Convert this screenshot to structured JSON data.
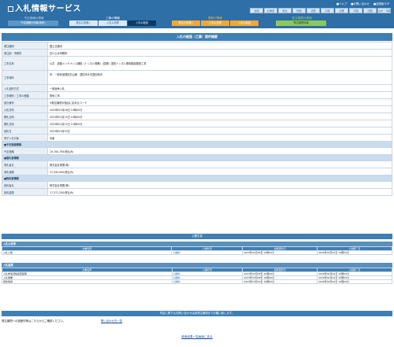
{
  "header": {
    "title": "入札情報サービス",
    "links": [
      "ヘルプ",
      "お問い合わせ",
      "全国版TOP"
    ],
    "prefectures": [
      "全国",
      "北海道",
      "東北",
      "関東",
      "北陸",
      "中部",
      "近畿",
      "中国",
      "四国",
      "九州・沖縄"
    ]
  },
  "categories": {
    "g1": {
      "label": "予定価格の情報",
      "tabs": [
        "予定価格の情報(参考)"
      ]
    },
    "g2": {
      "label": "工事の情報",
      "tabs": [
        "発注の見通し",
        "入札公告等",
        "入札の経過"
      ]
    },
    "g3": {
      "label": "業務の情報",
      "tabs": [
        "発注の見通し",
        "入札公告等",
        "入札の経過"
      ]
    },
    "g4": {
      "label": "発注機関の情報",
      "tabs": [
        "発注機関情報"
      ]
    }
  },
  "detail": {
    "heading": "入札の経過（工事）案件概要",
    "rows": [
      {
        "k": "発注機関",
        "v": "国土交通省"
      },
      {
        "k": "発注部・事務所",
        "v": "石川土木事務所"
      },
      {
        "k": "工事名称",
        "v": "公共　道路メンテナンス補助（トンネル照備）（国庫）蓮田トンネル照明施設更新工事"
      },
      {
        "k": "工事場所",
        "v": "市：一般県道蓮田白山線　蓮田市大字蓮田地内",
        "v2": "　"
      },
      {
        "k": "入札契約方式",
        "v": "一般競争入札"
      },
      {
        "k": "工事種別／工事の種類",
        "v": "電気工事"
      },
      {
        "k": "設計番号",
        "v": "※発注機関が独自に定めるコード"
      },
      {
        "k": "公告日時",
        "v": "2023年02月06日 10時00分"
      },
      {
        "k": "開札日時",
        "v": "2023年03月15日 10時00分"
      },
      {
        "k": "開札日時",
        "v": "2023年03月22日 11時00分"
      },
      {
        "k": "契約日",
        "v": "2023年03月30日"
      },
      {
        "k": "電子入札対象",
        "v": "対象"
      }
    ],
    "sub1": "■予定価格情報",
    "sub1_rows": [
      {
        "k": "予定価格",
        "v": "19,700,700(税込み)"
      }
    ],
    "sub2": "■落札者情報",
    "sub2_rows": [
      {
        "k": "落札者名",
        "v": "株式会社電業(株)"
      },
      {
        "k": "落札価格",
        "v": "17,545,900(税込み)"
      }
    ],
    "sub3": "■契約者情報",
    "sub3_rows": [
      {
        "k": "契約者名",
        "v": "株式会社電業(株)"
      },
      {
        "k": "契約金額",
        "v": "17,371,200(税込み)"
      }
    ]
  },
  "docs": {
    "heading": "公開文書",
    "columns": [
      "文書名称",
      "公開状況",
      "最終更新日",
      "公開終了日"
    ],
    "group1": {
      "title": "入札公告等",
      "rows": [
        {
          "name": "入札公告",
          "link": "公開中",
          "updated": "2023年02月06日 10時00分",
          "end": "2026年04月01日 10時00分"
        }
      ]
    },
    "group2": {
      "title": "入札結果",
      "rows": [
        {
          "name": "入札参加資格審査結果",
          "link": "公開中",
          "updated": "2023年02月28日 10時00分",
          "end": "2026年04月01日 10時00分"
        },
        {
          "name": "入札調書",
          "link": "公開中",
          "updated": "2023年03月28日 10時40分",
          "end": "2026年04月01日 10時00分"
        },
        {
          "name": "契約情報",
          "link": "公開中",
          "updated": "2023年03月30日 10時00分",
          "end": "2026年04月01日 10時00分"
        }
      ]
    }
  },
  "contact": {
    "heading": "内容に関するお問い合わせは各発注機関までお願い致します。",
    "text": "発注機関への連絡先等はこちらからご確認ください。",
    "link": "問い合わせ先一覧"
  },
  "back_link": "検索結果一覧画面に戻る"
}
